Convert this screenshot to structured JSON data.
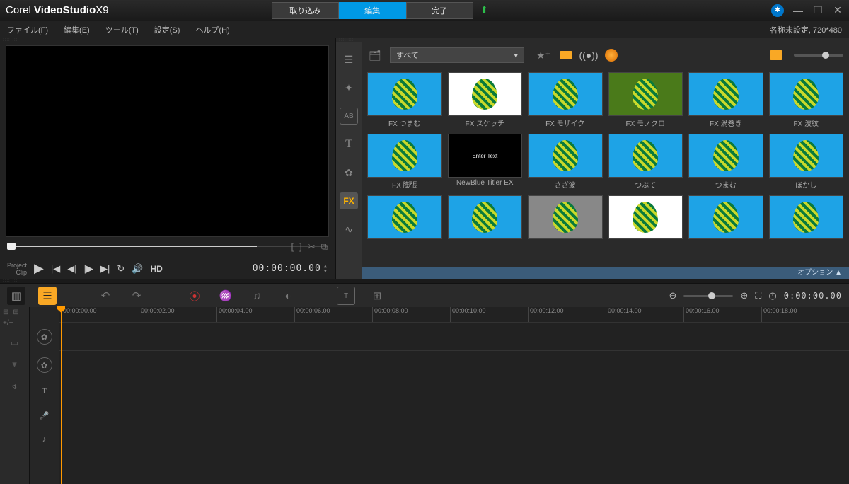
{
  "app": {
    "brand": "Corel",
    "product": "VideoStudio",
    "version": "X9"
  },
  "steps": {
    "capture": "取り込み",
    "edit": "編集",
    "share": "完了",
    "active": "edit"
  },
  "menus": {
    "file": "ファイル(F)",
    "edit": "編集(E)",
    "tools": "ツール(T)",
    "settings": "設定(S)",
    "help": "ヘルプ(H)"
  },
  "project_info": "名称未設定, 720*480",
  "preview": {
    "label_project": "Project",
    "label_clip": "Clip",
    "hd": "HD",
    "timecode": "00:00:00.00"
  },
  "library": {
    "side": [
      "media",
      "inst",
      "AB",
      "T",
      "trans",
      "FX",
      "path"
    ],
    "active_side": "FX",
    "fx_label": "FX",
    "dropdown": "すべて",
    "options_label": "オプション ▲",
    "items": [
      {
        "label": "FX つまむ",
        "bg": "sky"
      },
      {
        "label": "FX スケッチ",
        "bg": "wht"
      },
      {
        "label": "FX モザイク",
        "bg": "sky"
      },
      {
        "label": "FX モノクロ",
        "bg": "grn"
      },
      {
        "label": "FX 渦巻き",
        "bg": "sky"
      },
      {
        "label": "FX 波紋",
        "bg": "sky"
      },
      {
        "label": "FX 膨張",
        "bg": "sky"
      },
      {
        "label": "NewBlue Titler EX",
        "bg": "blk",
        "text": "Enter Text"
      },
      {
        "label": "さざ波",
        "bg": "sky"
      },
      {
        "label": "つぶて",
        "bg": "sky"
      },
      {
        "label": "つまむ",
        "bg": "sky"
      },
      {
        "label": "ぼかし",
        "bg": "sky"
      },
      {
        "label": "",
        "bg": "sky"
      },
      {
        "label": "",
        "bg": "sky"
      },
      {
        "label": "",
        "bg": "gry"
      },
      {
        "label": "",
        "bg": "wht"
      },
      {
        "label": "",
        "bg": "sky"
      },
      {
        "label": "",
        "bg": "sky"
      }
    ]
  },
  "timeline": {
    "zoom_tc": "0:00:00.00",
    "ruler": [
      "00:00:00.00",
      "00:00:02.00",
      "00:00:04.00",
      "00:00:06.00",
      "00:00:08.00",
      "00:00:10.00",
      "00:00:12.00",
      "00:00:14.00",
      "00:00:16.00",
      "00:00:18.00"
    ],
    "tracks": [
      "video",
      "overlay",
      "title",
      "voice",
      "music"
    ]
  }
}
